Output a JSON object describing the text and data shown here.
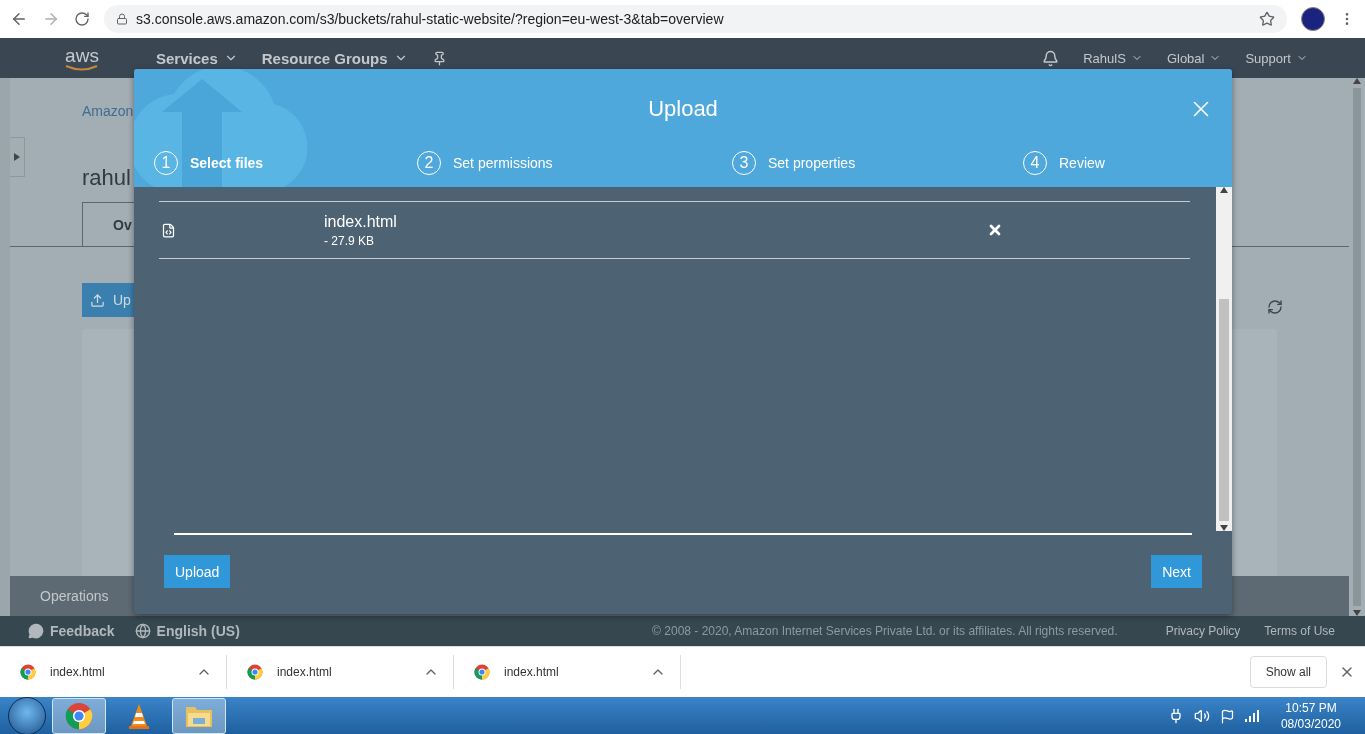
{
  "browser": {
    "url": "s3.console.aws.amazon.com/s3/buckets/rahul-static-website/?region=eu-west-3&tab=overview"
  },
  "aws_nav": {
    "logo": "aws",
    "menus": [
      "Services",
      "Resource Groups"
    ],
    "user_menus": [
      "RahulS",
      "Global",
      "Support"
    ]
  },
  "page": {
    "breadcrumb": "Amazon",
    "bucket_title": "rahul",
    "tabs": [
      {
        "label": "Ov",
        "selected": true
      }
    ],
    "upload_button": "Up",
    "operations_bar": "Operations"
  },
  "dialog": {
    "title": "Upload",
    "steps": [
      {
        "number": "1",
        "label": "Select files",
        "selected": true
      },
      {
        "number": "2",
        "label": "Set permissions",
        "selected": false
      },
      {
        "number": "3",
        "label": "Set properties",
        "selected": false
      },
      {
        "number": "4",
        "label": "Review",
        "selected": false
      }
    ],
    "files": [
      {
        "name": "index.html",
        "size": "- 27.9 KB"
      }
    ],
    "upload_button": "Upload",
    "next_button": "Next"
  },
  "footer": {
    "feedback": "Feedback",
    "language": "English (US)",
    "copyright": "© 2008 - 2020, Amazon Internet Services Private Ltd. or its affiliates. All rights reserved.",
    "links": [
      "Privacy Policy",
      "Terms of Use"
    ]
  },
  "downloads": {
    "items": [
      "index.html",
      "index.html",
      "index.html"
    ],
    "show_all": "Show all"
  },
  "taskbar": {
    "time": "10:57 PM",
    "date": "08/03/2020"
  }
}
